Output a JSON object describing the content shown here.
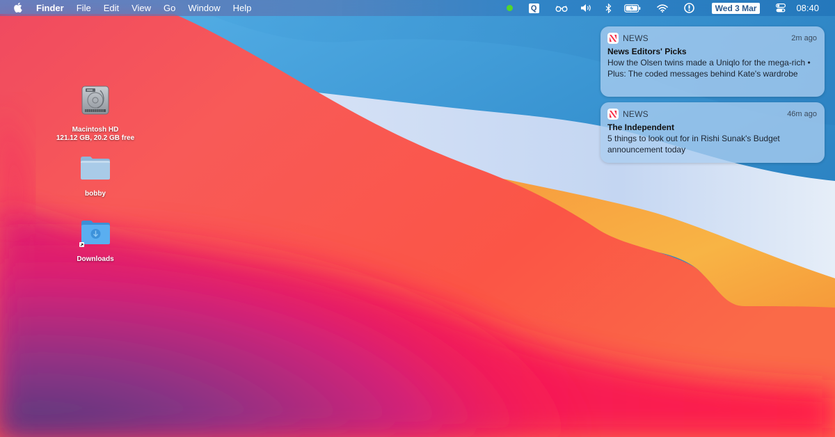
{
  "menubar": {
    "apple_icon": "apple-logo-icon",
    "app_name": "Finder",
    "menus": [
      "File",
      "Edit",
      "View",
      "Go",
      "Window",
      "Help"
    ],
    "status_items": [
      {
        "name": "green-status-dot-icon",
        "color": "#52d62a"
      },
      {
        "name": "q-app-icon",
        "text": "Q"
      },
      {
        "name": "glasses-icon"
      },
      {
        "name": "volume-icon"
      },
      {
        "name": "bluetooth-icon"
      },
      {
        "name": "battery-charging-icon"
      },
      {
        "name": "wifi-icon"
      },
      {
        "name": "1password-icon"
      }
    ],
    "date": "Wed 3 Mar",
    "control_center_icon": "control-center-icon",
    "time": "08:40"
  },
  "desktop": {
    "icons": [
      {
        "name": "Macintosh HD",
        "subtitle": "121.12 GB, 20.2 GB free",
        "icon": "hard-drive-icon"
      },
      {
        "name": "bobby",
        "icon": "folder-icon"
      },
      {
        "name": "Downloads",
        "icon": "downloads-folder-icon"
      }
    ]
  },
  "notifications": [
    {
      "app": "NEWS",
      "time": "2m ago",
      "title": "News Editors' Picks",
      "body": "How the Olsen twins made a Uniqlo for the mega-rich • Plus: The coded messages behind Kate's wardrobe"
    },
    {
      "app": "NEWS",
      "time": "46m ago",
      "title": "The Independent",
      "body": "5 things to look out for in Rishi Sunak's Budget announcement today"
    }
  ],
  "colors": {
    "news_red": "#f7304a",
    "menubar_text": "#ffffff",
    "date_badge_text": "#2a5a90"
  }
}
